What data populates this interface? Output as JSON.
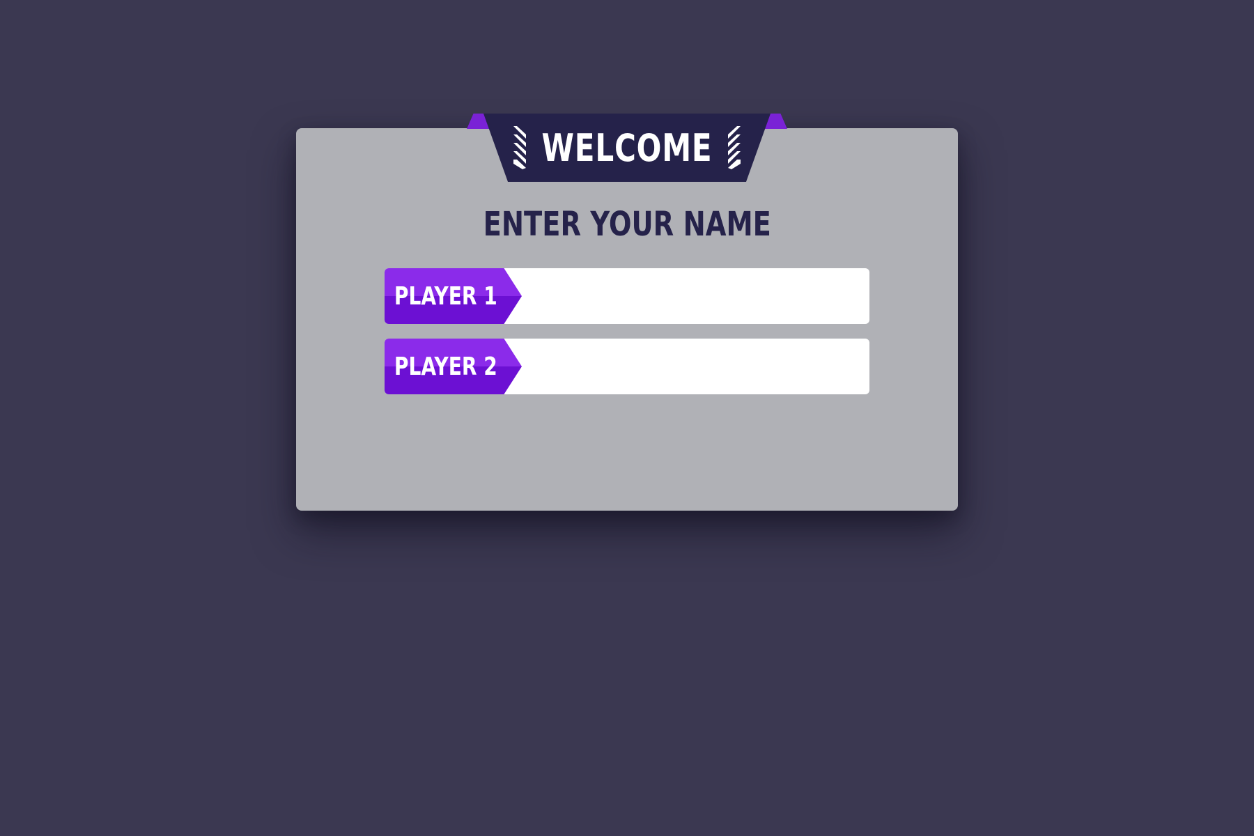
{
  "colors": {
    "background": "#3b3851",
    "card": "#b0b1b6",
    "banner": "#25224a",
    "accent_purple": "#7a22d6",
    "tag_top": "#8b2bea",
    "tag_bottom": "#6c10d3",
    "input_bg": "#ffffff"
  },
  "banner": {
    "title": "WELCOME",
    "left_icon": "chevron-stripes-icon",
    "right_icon": "chevron-stripes-icon"
  },
  "form": {
    "heading": "ENTER YOUR NAME",
    "players": [
      {
        "label": "PLAYER 1",
        "value": "",
        "placeholder": ""
      },
      {
        "label": "PLAYER 2",
        "value": "",
        "placeholder": ""
      }
    ]
  }
}
